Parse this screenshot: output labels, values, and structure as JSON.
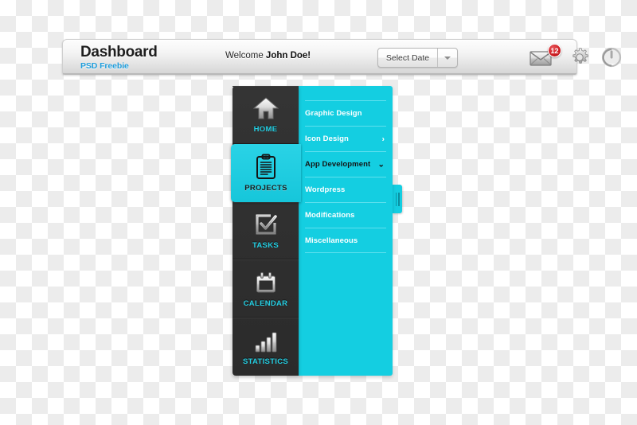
{
  "header": {
    "title": "Dashboard",
    "subtitle": "PSD Freebie",
    "welcome_prefix": "Welcome ",
    "welcome_user": "John Doe!",
    "date_select": {
      "label": "Select Date",
      "icon": "chevron-down-icon"
    },
    "icons": [
      {
        "name": "mail-icon",
        "badge": "12"
      },
      {
        "name": "gear-icon",
        "badge": ""
      },
      {
        "name": "power-icon",
        "badge": ""
      }
    ]
  },
  "sidebar": {
    "items": [
      {
        "label": "HOME",
        "icon": "home-icon",
        "active": false
      },
      {
        "label": "PROJECTS",
        "icon": "clipboard-icon",
        "active": true
      },
      {
        "label": "TASKS",
        "icon": "checkbox-icon",
        "active": false
      },
      {
        "label": "CALENDAR",
        "icon": "calendar-icon",
        "active": false
      },
      {
        "label": "STATISTICS",
        "icon": "bar-chart-icon",
        "active": false
      }
    ]
  },
  "submenu": {
    "items": [
      {
        "label": "Graphic Design",
        "arrow": "",
        "expanded": false
      },
      {
        "label": "Icon Design",
        "arrow": "›",
        "expanded": false
      },
      {
        "label": "App Development",
        "arrow": "⌄",
        "expanded": true
      },
      {
        "label": "Wordpress",
        "arrow": "",
        "expanded": false
      },
      {
        "label": "Modifications",
        "arrow": "",
        "expanded": false
      },
      {
        "label": "Miscellaneous",
        "arrow": "",
        "expanded": false
      }
    ],
    "handle_icon": "drag-handle-icon"
  },
  "colors": {
    "cyan": "#14cee1",
    "dark": "#2e2e2e",
    "accent_blue": "#1f9ddb",
    "badge_red": "#cc1d22"
  }
}
